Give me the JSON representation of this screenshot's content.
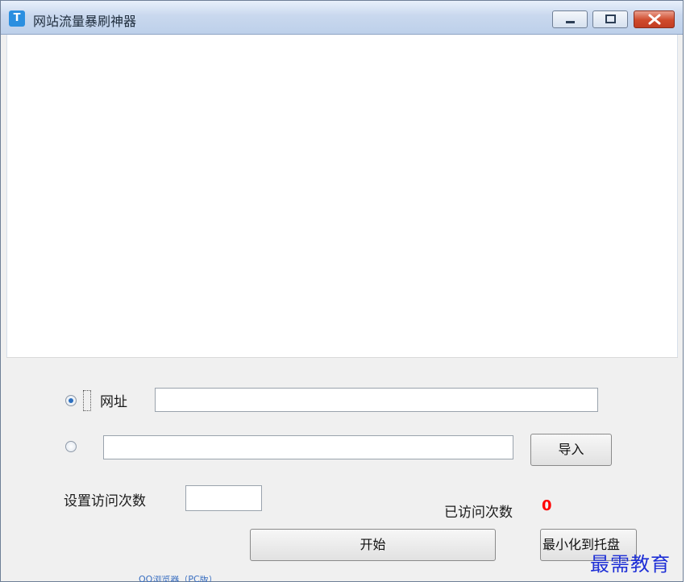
{
  "window": {
    "title": "网站流量暴刷神器",
    "icon": "app-logo-icon"
  },
  "form": {
    "url_radio_label": "网址",
    "url_value": "",
    "file_value": "",
    "import_button": "导入",
    "visit_count_label": "设置访问次数",
    "visit_count_value": "",
    "visited_label": "已访问次数",
    "visited_count": "0",
    "start_button": "开始",
    "minimize_button": "最小化到托盘"
  },
  "overlay": {
    "watermark": "最需教育",
    "bottom_strip_text": "QQ浏览器（PC版）"
  },
  "colors": {
    "visited_count": "#ff0000",
    "watermark": "#1e2fd6"
  }
}
